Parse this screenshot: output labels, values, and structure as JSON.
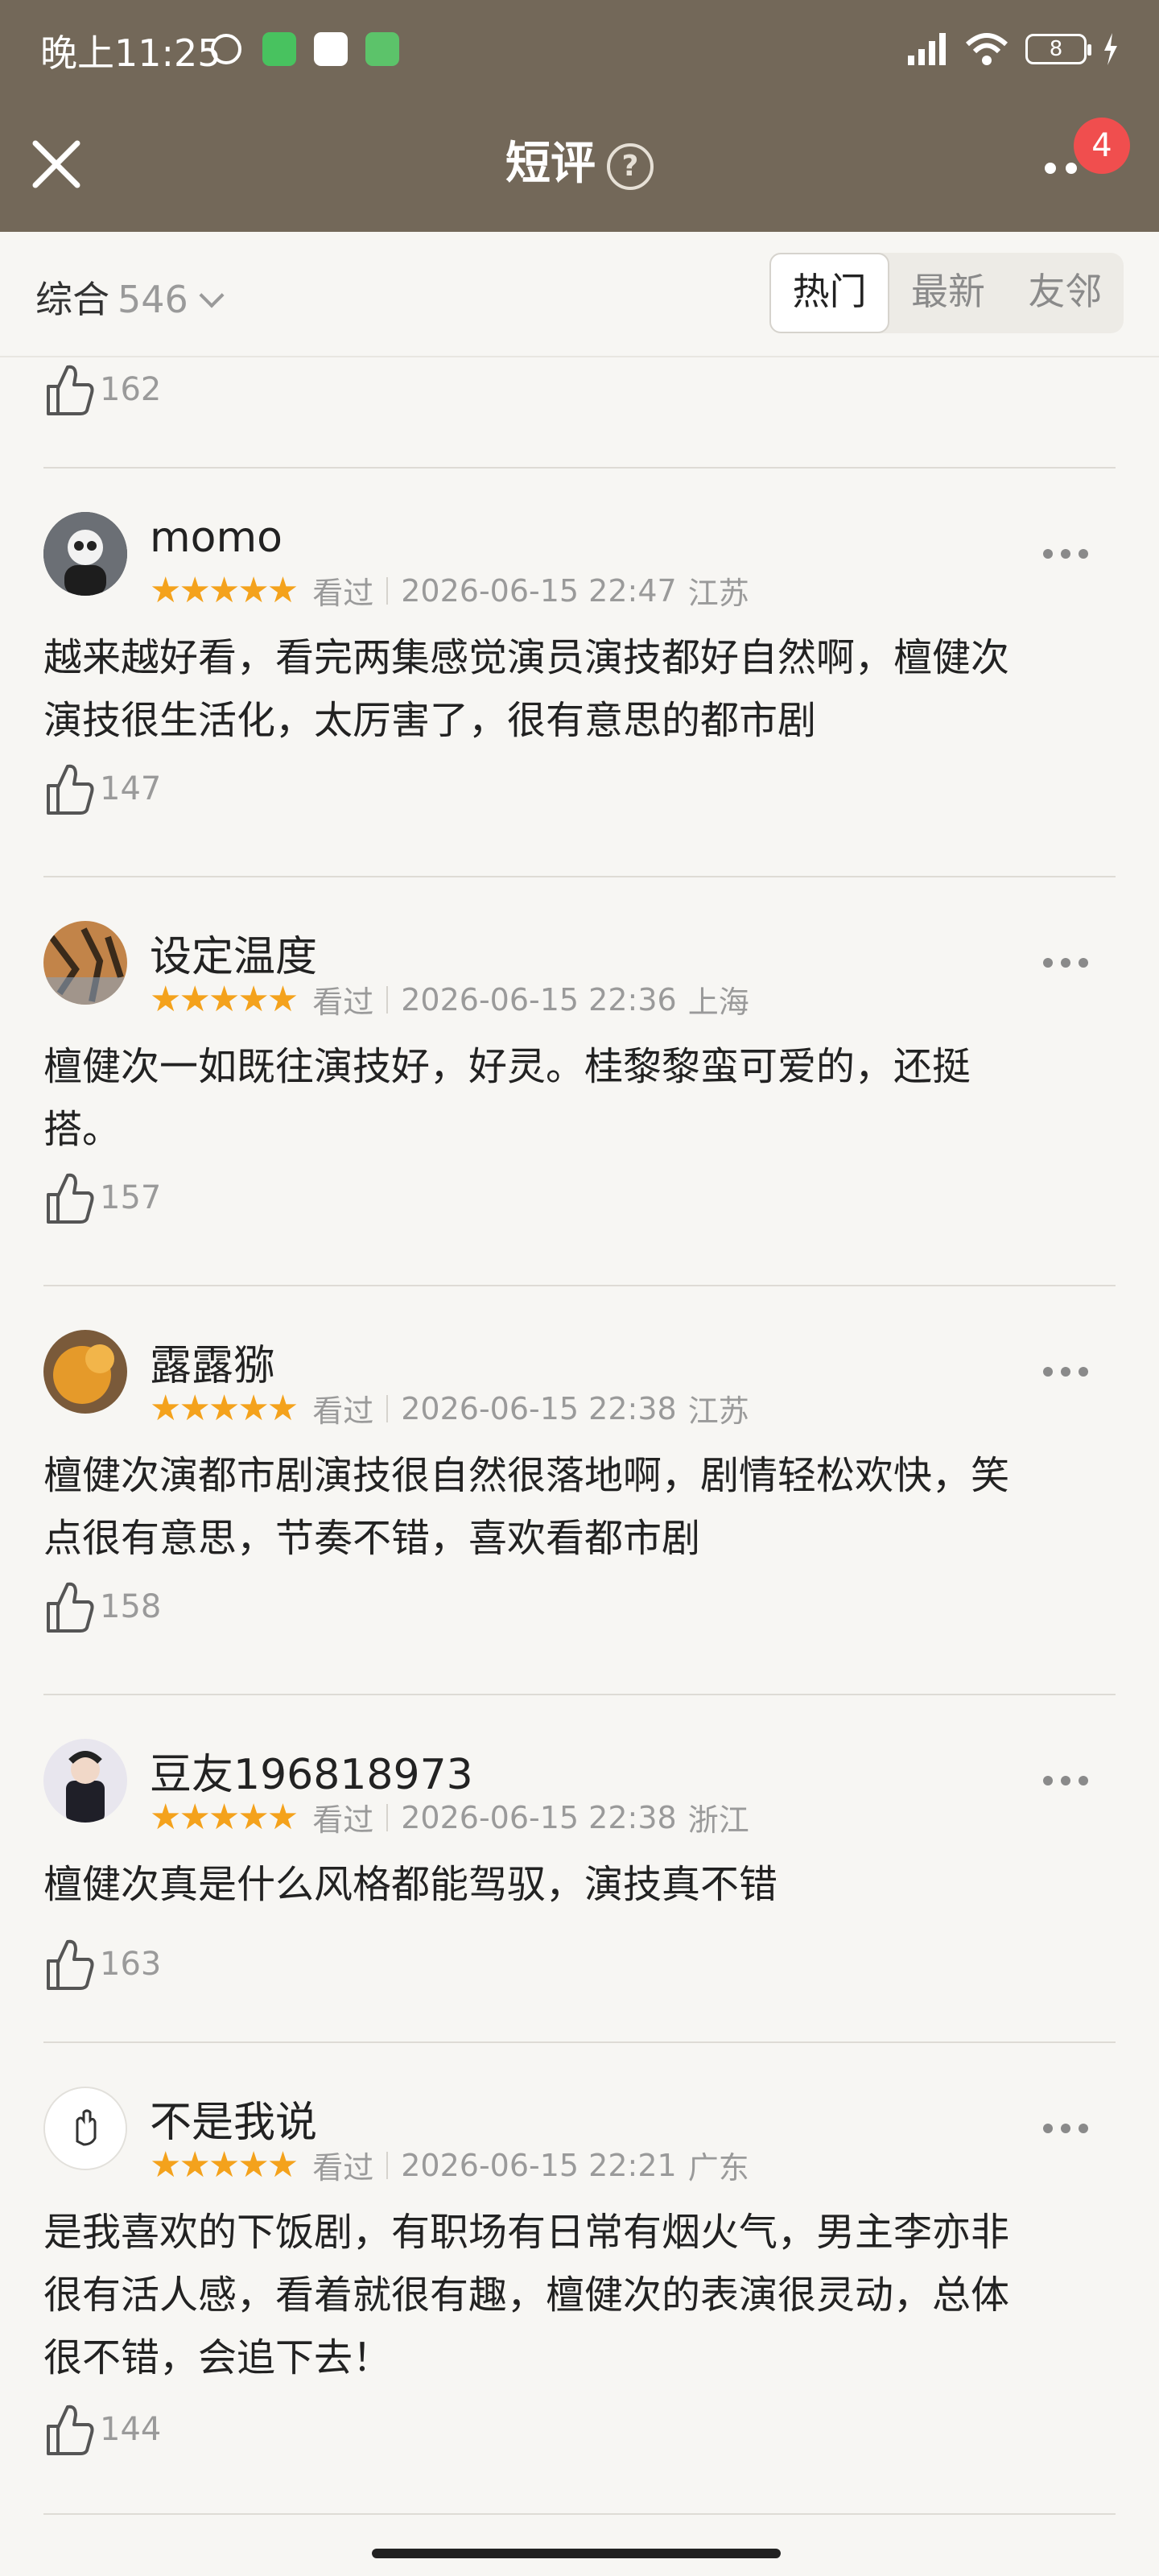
{
  "status_bar": {
    "time": "晚上11:25",
    "battery": "8"
  },
  "nav": {
    "title": "短评",
    "help": "?",
    "badge": "4"
  },
  "filter": {
    "sort_label": "综合",
    "count": "546",
    "tabs": [
      "热门",
      "最新",
      "友邻"
    ],
    "active_tab": "热门"
  },
  "prev_like": "162",
  "reviews": [
    {
      "user": "momo",
      "stars": "★★★★★",
      "status": "看过",
      "time": "2026-06-15 22:47",
      "location": "江苏",
      "text_lines": [
        "越来越好看，看完两集感觉演员演技都好自然啊，檀健次",
        "演技很生活化，太厉害了，很有意思的都市剧"
      ],
      "likes": "147",
      "avatar_color": "#3a3a3a"
    },
    {
      "user": "设定温度",
      "stars": "★★★★★",
      "status": "看过",
      "time": "2026-06-15 22:36",
      "location": "上海",
      "text_lines": [
        "檀健次一如既往演技好，好灵。桂黎黎蛮可爱的，还挺",
        "搭。"
      ],
      "likes": "157",
      "avatar_color": "#a86b3c"
    },
    {
      "user": "露露猕",
      "stars": "★★★★★",
      "status": "看过",
      "time": "2026-06-15 22:38",
      "location": "江苏",
      "text_lines": [
        "檀健次演都市剧演技很自然很落地啊，剧情轻松欢快，笑",
        "点很有意思，节奏不错，喜欢看都市剧"
      ],
      "likes": "158",
      "avatar_color": "#d9902a"
    },
    {
      "user": "豆友196818973",
      "stars": "★★★★★",
      "status": "看过",
      "time": "2026-06-15 22:38",
      "location": "浙江",
      "text_lines": [
        "檀健次真是什么风格都能驾驭，演技真不错"
      ],
      "likes": "163",
      "avatar_color": "#2c2c34"
    },
    {
      "user": "不是我说",
      "stars": "★★★★★",
      "status": "看过",
      "time": "2026-06-15 22:21",
      "location": "广东",
      "text_lines": [
        "是我喜欢的下饭剧，有职场有日常有烟火气，男主李亦非",
        "很有活人感，看着就很有趣，檀健次的表演很灵动，总体",
        "很不错，会追下去！"
      ],
      "likes": "144",
      "avatar_color": "#ffffff"
    }
  ]
}
